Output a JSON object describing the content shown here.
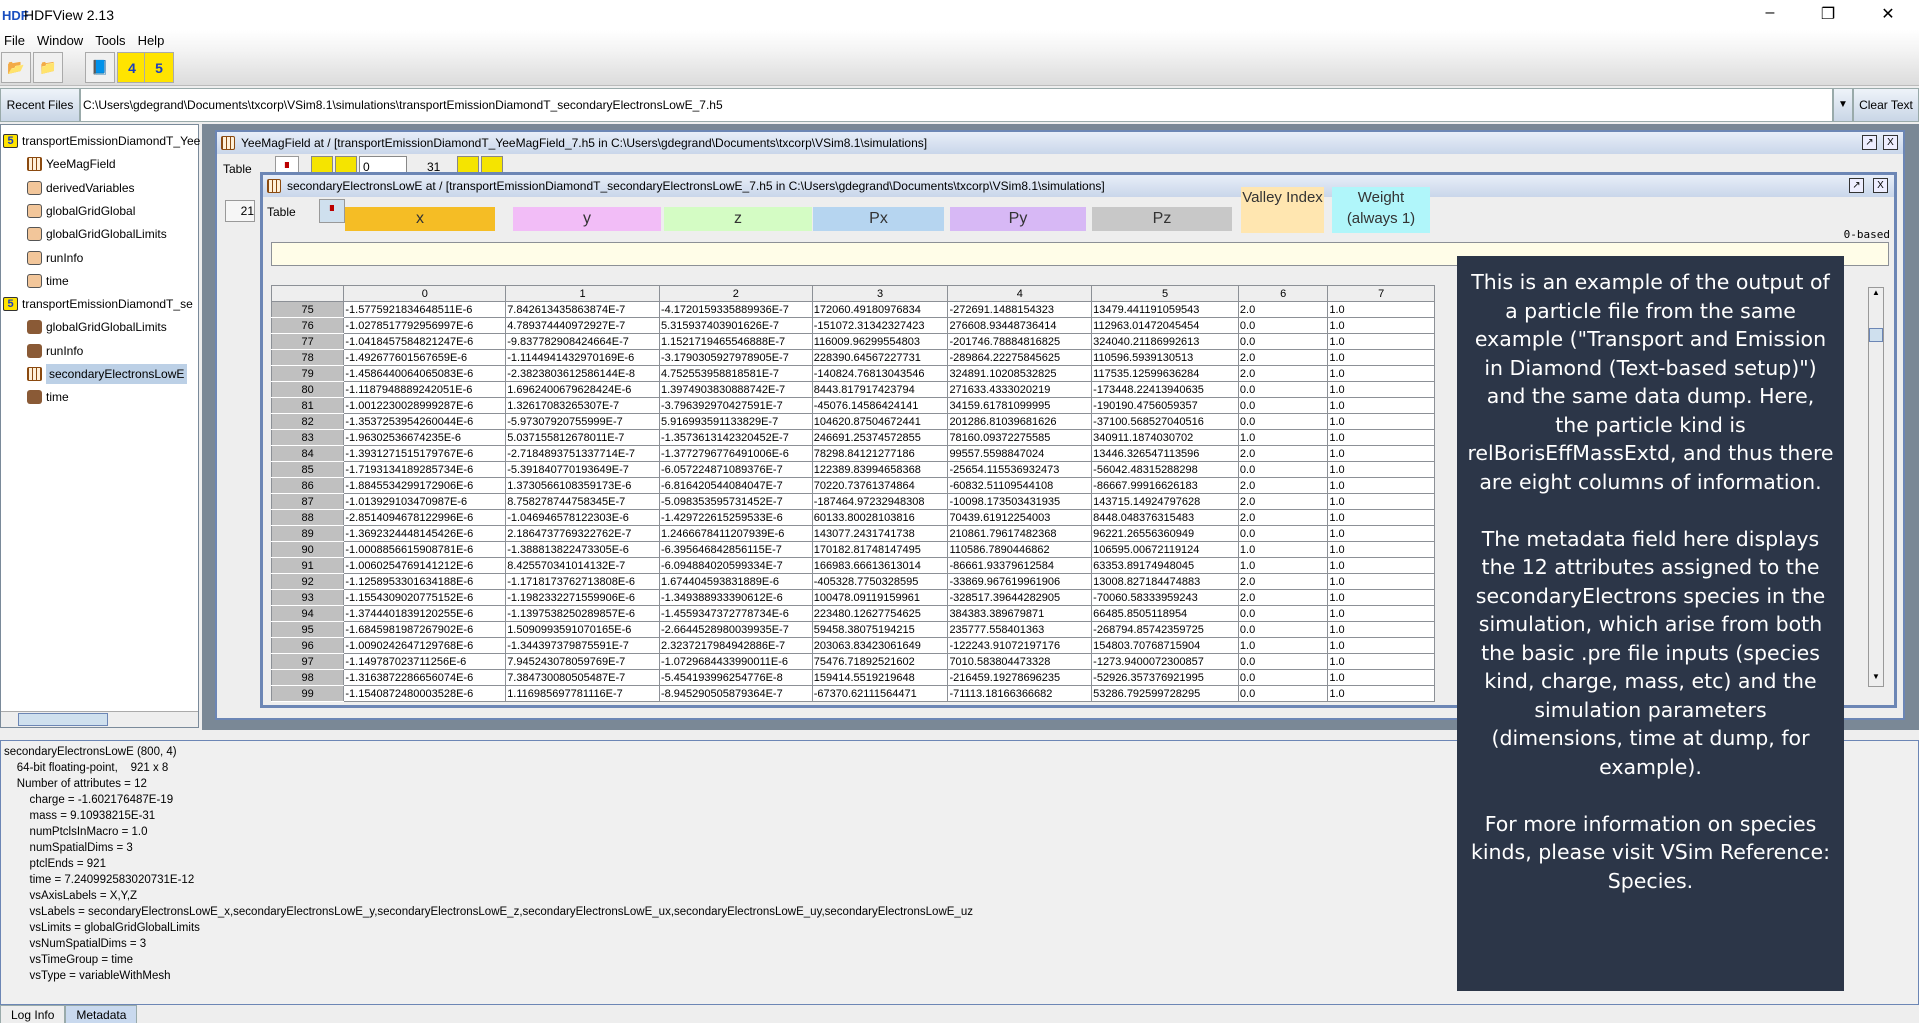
{
  "window": {
    "title": "HDFView 2.13",
    "logo": "HDF",
    "controls": [
      "minimize-icon",
      "maximize-icon",
      "close-icon"
    ]
  },
  "menu": [
    "File",
    "Window",
    "Tools",
    "Help"
  ],
  "toolbar": {
    "buttons": [
      "open-file-icon",
      "open-readonly-icon",
      "help-book-icon",
      "hdf4-library-icon",
      "hdf5-library-icon"
    ],
    "h4": "4",
    "h5": "5"
  },
  "recent": {
    "label": "Recent Files",
    "path": "C:\\Users\\gdegrand\\Documents\\txcorp\\VSim8.1\\simulations\\transportEmissionDiamondT_secondaryElectronsLowE_7.h5",
    "clear": "Clear Text"
  },
  "tree": [
    {
      "label": "transportEmissionDiamondT_Yee",
      "type": "h5",
      "level": 0
    },
    {
      "label": "YeeMagField",
      "type": "dataset",
      "level": 1
    },
    {
      "label": "derivedVariables",
      "type": "group",
      "level": 1
    },
    {
      "label": "globalGridGlobal",
      "type": "group",
      "level": 1
    },
    {
      "label": "globalGridGlobalLimits",
      "type": "group",
      "level": 1
    },
    {
      "label": "runInfo",
      "type": "group",
      "level": 1
    },
    {
      "label": "time",
      "type": "group",
      "level": 1
    },
    {
      "label": "transportEmissionDiamondT_se",
      "type": "h5",
      "level": 0
    },
    {
      "label": "globalGridGlobalLimits",
      "type": "group2",
      "level": 1
    },
    {
      "label": "runInfo",
      "type": "group2",
      "level": 1
    },
    {
      "label": "secondaryElectronsLowE",
      "type": "dataset",
      "level": 1,
      "selected": true
    },
    {
      "label": "time",
      "type": "group2",
      "level": 1
    }
  ],
  "yee_frame": {
    "title": "YeeMagField  at  /  [transportEmissionDiamondT_YeeMagField_7.h5  in  C:\\Users\\gdegrand\\Documents\\txcorp\\VSim8.1\\simulations]",
    "menu": "Table",
    "page": "0",
    "max": "31",
    "rowstub": "21"
  },
  "sec_frame": {
    "title": "secondaryElectronsLowE  at  /  [transportEmissionDiamondT_secondaryElectronsLowE_7.h5  in  C:\\Users\\gdegrand\\Documents\\txcorp\\VSim8.1\\simulations]",
    "menu": "Table",
    "indexing": "0-based"
  },
  "column_labels": [
    {
      "text": "x",
      "color": "#f5bd25"
    },
    {
      "text": "y",
      "color": "#f2bdf7"
    },
    {
      "text": "z",
      "color": "#d4fcc4"
    },
    {
      "text": "Px",
      "color": "#b6d5f0"
    },
    {
      "text": "Py",
      "color": "#d7b8f5"
    },
    {
      "text": "Pz",
      "color": "#c8c8c8"
    },
    {
      "text": "Valley Index",
      "color": "#ffe6b0"
    },
    {
      "text": "Weight (always 1)",
      "color": "#b0f6fa"
    }
  ],
  "table": {
    "headers": [
      "0",
      "1",
      "2",
      "3",
      "4",
      "5",
      "6",
      "7"
    ],
    "rows": [
      [
        "75",
        "-1.5775921834648511E-6",
        "7.842613435863874E-7",
        "-4.1720159335889936E-7",
        "172060.49180976834",
        "-272691.1488154323",
        "13479.441191059543",
        "2.0",
        "1.0"
      ],
      [
        "76",
        "-1.0278517792956997E-6",
        "4.789374440972927E-7",
        "5.315937403901626E-7",
        "-151072.31342327423",
        "276608.93448736414",
        "112963.01472045454",
        "0.0",
        "1.0"
      ],
      [
        "77",
        "-1.0418457584821247E-6",
        "-9.837782908424664E-7",
        "1.1521719465546888E-7",
        "116009.96299554803",
        "-201746.78884816825",
        "324040.21186992613",
        "0.0",
        "1.0"
      ],
      [
        "78",
        "-1.492677601567659E-6",
        "-1.1144941432970169E-6",
        "-3.1790305927978905E-7",
        "228390.64567227731",
        "-289864.22275845625",
        "110596.5939130513",
        "2.0",
        "1.0"
      ],
      [
        "79",
        "-1.4586440064065083E-6",
        "-2.3823803612586144E-8",
        "4.752553958818581E-7",
        "-140824.76813043546",
        "324891.10208532825",
        "117535.12599636284",
        "2.0",
        "1.0"
      ],
      [
        "80",
        "-1.1187948889242051E-6",
        "1.6962400679628424E-6",
        "1.3974903830888742E-7",
        "8443.817917423794",
        "271633.4333020219",
        "-173448.22413940635",
        "0.0",
        "1.0"
      ],
      [
        "81",
        "-1.0012230028999287E-6",
        "1.32617083265307E-7",
        "-3.796392970427591E-7",
        "-45076.14586424141",
        "34159.61781099995",
        "-190190.4756059357",
        "0.0",
        "1.0"
      ],
      [
        "82",
        "-1.3537253954260044E-6",
        "-5.97307920755999E-7",
        "5.916993591133829E-7",
        "104620.87504672441",
        "201286.81039681626",
        "-37100.568527040516",
        "0.0",
        "1.0"
      ],
      [
        "83",
        "-1.96302536674235E-6",
        "5.037155812678011E-7",
        "-1.3573613142320452E-7",
        "246691.25374572855",
        "78160.09372275585",
        "340911.1874030702",
        "1.0",
        "1.0"
      ],
      [
        "84",
        "-1.3931271515179767E-6",
        "-2.7184893751337714E-7",
        "-1.3772796776491006E-6",
        "78298.84121277186",
        "99557.5598847024",
        "13446.326547113596",
        "2.0",
        "1.0"
      ],
      [
        "85",
        "-1.7193134189285734E-6",
        "-5.391840770193649E-7",
        "-6.057224871089376E-7",
        "122389.83994658368",
        "-25654.115536932473",
        "-56042.48315288298",
        "0.0",
        "1.0"
      ],
      [
        "86",
        "-1.8845534299172906E-6",
        "1.3730566108359173E-6",
        "-6.816420544084047E-7",
        "70220.73761374864",
        "-60832.51109544108",
        "-86667.99916626183",
        "2.0",
        "1.0"
      ],
      [
        "87",
        "-1.013929103470987E-6",
        "8.758278744758345E-7",
        "-5.098353595731452E-7",
        "-187464.97232948308",
        "-10098.173503431935",
        "143715.14924797628",
        "2.0",
        "1.0"
      ],
      [
        "88",
        "-2.8514094678122996E-6",
        "-1.046946578122303E-6",
        "-1.429722615259533E-6",
        "60133.80028103816",
        "70439.61912254003",
        "8448.048376315483",
        "2.0",
        "1.0"
      ],
      [
        "89",
        "-1.3692324448145426E-6",
        "2.1864737769322762E-7",
        "1.2466678411207939E-6",
        "143077.2431741738",
        "210861.79617482368",
        "96221.26556360949",
        "0.0",
        "1.0"
      ],
      [
        "90",
        "-1.0008856615908781E-6",
        "-1.388813822473305E-6",
        "-6.395646842856115E-7",
        "170182.81748147495",
        "110586.7890446862",
        "106595.00672119124",
        "1.0",
        "1.0"
      ],
      [
        "91",
        "-1.0060254769141212E-6",
        "8.425570341014132E-7",
        "-6.094884020599334E-7",
        "166983.66613613014",
        "-86661.93379612584",
        "63353.89174948045",
        "1.0",
        "1.0"
      ],
      [
        "92",
        "-1.1258953301634188E-6",
        "-1.1718173762713808E-6",
        "1.674404593831889E-6",
        "-405328.7750328595",
        "-33869.967619961906",
        "13008.827184474883",
        "2.0",
        "1.0"
      ],
      [
        "93",
        "-1.1554309020775152E-6",
        "-1.1982332271559906E-6",
        "-1.349388933390612E-6",
        "100478.09119159961",
        "-328517.39644282905",
        "-70060.58333959243",
        "2.0",
        "1.0"
      ],
      [
        "94",
        "-1.3744401839120255E-6",
        "-1.1397538250289857E-6",
        "-1.4559347372778734E-6",
        "223480.12627754625",
        "384383.389679871",
        "66485.8505118954",
        "0.0",
        "1.0"
      ],
      [
        "95",
        "-1.6845981987267902E-6",
        "1.5090993591070165E-6",
        "-2.6644528980039935E-7",
        "59458.38075194215",
        "235777.558401363",
        "-268794.85742359725",
        "0.0",
        "1.0"
      ],
      [
        "96",
        "-1.0090242647129768E-6",
        "-1.344397379875591E-7",
        "2.3237217984942886E-7",
        "203063.83423061649",
        "-122243.91072197176",
        "154803.70768715904",
        "1.0",
        "1.0"
      ],
      [
        "97",
        "-1.149787023711256E-6",
        "7.945243078059769E-7",
        "-1.0729684433990011E-6",
        "75476.71892521602",
        "7010.583804473328",
        "-1273.9400072300857",
        "0.0",
        "1.0"
      ],
      [
        "98",
        "-1.3163872286656074E-6",
        "7.384730080505487E-7",
        "-5.454193996254776E-8",
        "159414.5519219648",
        "-216459.19278696235",
        "-52926.357376921995",
        "0.0",
        "1.0"
      ],
      [
        "99",
        "-1.1540872480003528E-6",
        "1.116985697781116E-7",
        "-8.945290505879364E-7",
        "-67370.62111564471",
        "-71113.18166366682",
        "53286.792599728295",
        "0.0",
        "1.0"
      ]
    ]
  },
  "note": {
    "p1": "This is an example of the output of a particle file from the same example (\"Transport and Emission in Diamond (Text-based setup)\") and the same data dump.  Here, the particle kind is relBorisEffMassExtd, and thus there are eight columns of information.",
    "p2": "The metadata field here displays the 12 attributes assigned to the secondaryElectrons species in the simulation, which arise from both the basic .pre file inputs (species kind, charge, mass, etc) and the simulation parameters (dimensions, time at dump, for example).",
    "p3": "For more information on species kinds, please visit VSim Reference: Species."
  },
  "metadata": [
    "secondaryElectronsLowE (800, 4)",
    "    64-bit floating-point,    921 x 8",
    "    Number of attributes = 12",
    "        charge = -1.602176487E-19",
    "        mass = 9.10938215E-31",
    "        numPtclsInMacro = 1.0",
    "        numSpatialDims = 3",
    "        ptclEnds = 921",
    "        time = 7.240992583020731E-12",
    "        vsAxisLabels = X,Y,Z",
    "        vsLabels = secondaryElectronsLowE_x,secondaryElectronsLowE_y,secondaryElectronsLowE_z,secondaryElectronsLowE_ux,secondaryElectronsLowE_uy,secondaryElectronsLowE_uz",
    "        vsLimits = globalGridGlobalLimits",
    "        vsNumSpatialDims = 3",
    "        vsTimeGroup = time",
    "        vsType = variableWithMesh"
  ],
  "tabs": [
    {
      "label": "Log Info",
      "active": false
    },
    {
      "label": "Metadata",
      "active": true
    }
  ]
}
